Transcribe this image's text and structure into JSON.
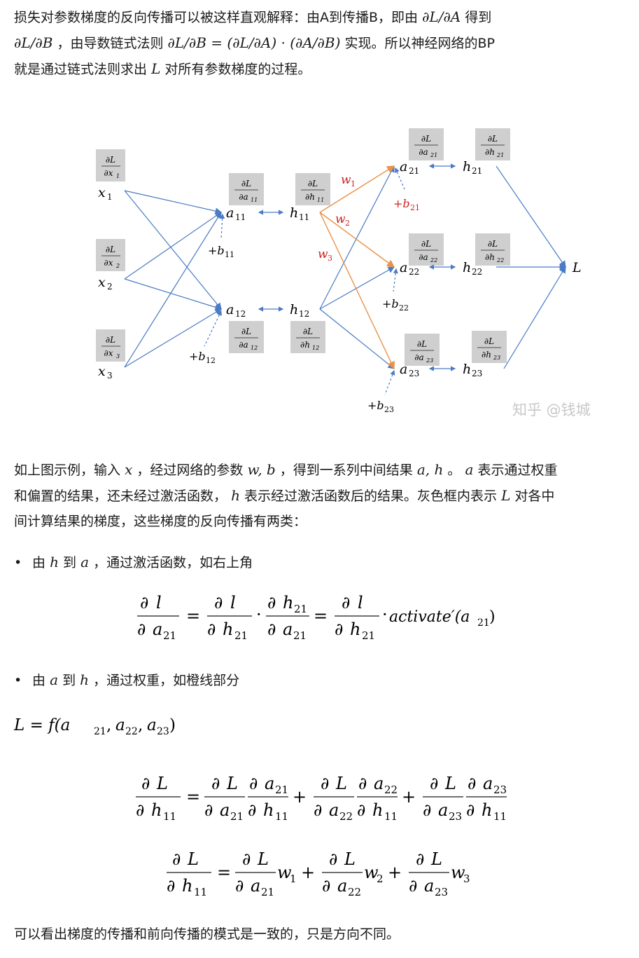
{
  "intro": {
    "l1_a": "损失对参数梯度的反向传播可以被这样直观解释：由A到传播B，即由",
    "l1_m": "∂L/∂A",
    "l1_b": "得到",
    "l2_m1": "∂L/∂B",
    "l2_a": "，由导数链式法则",
    "l2_m2": "∂L/∂B = (∂L/∂A) · (∂A/∂B)",
    "l2_b": "实现。所以神经网络的BP",
    "l3_a": "就是通过链式法则求出",
    "l3_m": "L",
    "l3_b": "对所有参数梯度的过程。"
  },
  "diagram": {
    "nodes": {
      "x1": "x",
      "x1_sub": "1",
      "x2": "x",
      "x2_sub": "2",
      "x3": "x",
      "x3_sub": "3",
      "a11": "a",
      "a11_sub": "11",
      "a12": "a",
      "a12_sub": "12",
      "h11": "h",
      "h11_sub": "11",
      "h12": "h",
      "h12_sub": "12",
      "a21": "a",
      "a21_sub": "21",
      "a22": "a",
      "a22_sub": "22",
      "a23": "a",
      "a23_sub": "23",
      "h21": "h",
      "h21_sub": "21",
      "h22": "h",
      "h22_sub": "22",
      "h23": "h",
      "h23_sub": "23",
      "L": "L"
    },
    "biases": {
      "b11": "+b",
      "b11_sub": "11",
      "b12": "+b",
      "b12_sub": "12",
      "b21": "+b",
      "b21_sub": "21",
      "b22": "+b",
      "b22_sub": "22",
      "b23": "+b",
      "b23_sub": "23"
    },
    "weights": {
      "w1": "w",
      "w1_sub": "1",
      "w2": "w",
      "w2_sub": "2",
      "w3": "w",
      "w3_sub": "3"
    },
    "grad_boxes": {
      "num": "∂L",
      "gx1": "∂x",
      "gx1_sub": "1",
      "gx2": "∂x",
      "gx2_sub": "2",
      "gx3": "∂x",
      "gx3_sub": "3",
      "ga11": "∂a",
      "ga11_sub": "11",
      "ga12": "∂a",
      "ga12_sub": "12",
      "gh11": "∂h",
      "gh11_sub": "11",
      "gh12": "∂h",
      "gh12_sub": "12",
      "ga21": "∂a",
      "ga21_sub": "21",
      "ga22": "∂a",
      "ga22_sub": "22",
      "ga23": "∂a",
      "ga23_sub": "23",
      "gh21": "∂h",
      "gh21_sub": "21",
      "gh22": "∂h",
      "gh22_sub": "22",
      "gh23": "∂h",
      "gh23_sub": "23"
    },
    "watermark": "知乎 @钱城",
    "colors": {
      "blue": "#4a7bc4",
      "orange": "#e8924a",
      "red": "#d02020",
      "box": "#cfcfcf"
    }
  },
  "para2": {
    "a": "如上图示例，输入",
    "m1": "x",
    "b": "，经过网络的参数",
    "m2": "w, b",
    "c": "，得到一系列中间结果",
    "m3": "a, h",
    "d": "。",
    "m4": "a",
    "e": "表示通过权重",
    "l2_a": "和偏置的结果，还未经过激活函数，",
    "l2_m": "h",
    "l2_b": "表示经过激活函数后的结果。灰色框内表示",
    "l2_m2": "L",
    "l2_c": "对各中",
    "l3": "间计算结果的梯度，这些梯度的反向传播有两类："
  },
  "bullet1": {
    "dot": "•",
    "a": "由",
    "m1": "h",
    "b": "到",
    "m2": "a",
    "c": "，通过激活函数，如右上角"
  },
  "bullet2": {
    "dot": "•",
    "a": "由",
    "m1": "a",
    "b": "到",
    "m2": "h",
    "c": "，通过权重，如橙线部分"
  },
  "equations": {
    "e1": {
      "d": "∂",
      "l": "l",
      "a": "a",
      "h": "h",
      "s21": "21",
      "dot": "·",
      "eq": "=",
      "act": "activate′(a",
      "close": ")"
    },
    "e2": {
      "lhs": "L = f(a",
      "s21": "21",
      "s22": "22",
      "s23": "23",
      "comma": ",",
      "close": ")"
    },
    "e3": {
      "d": "∂",
      "L": "L",
      "a": "a",
      "h": "h",
      "s11": "11",
      "s21": "21",
      "s22": "22",
      "s23": "23",
      "eq": "=",
      "plus": "+"
    },
    "e4": {
      "d": "∂",
      "L": "L",
      "a": "a",
      "h": "h",
      "w": "w",
      "s1": "1",
      "s2": "2",
      "s3": "3",
      "s11": "11",
      "s21": "21",
      "s22": "22",
      "s23": "23",
      "eq": "=",
      "plus": "+"
    }
  },
  "conclusion": "可以看出梯度的传播和前向传播的模式是一致的，只是方向不同。"
}
